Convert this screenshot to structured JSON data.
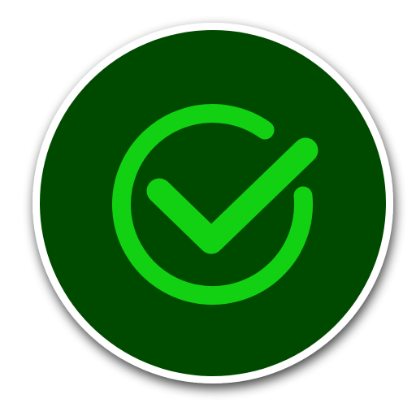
{
  "icon": {
    "name": "check-circle-icon",
    "colors": {
      "disc": "#004a00",
      "ring": "#ffffff",
      "glyph": "#12d012",
      "glyph_highlight": "#22e022",
      "shadow": "#000000"
    }
  }
}
